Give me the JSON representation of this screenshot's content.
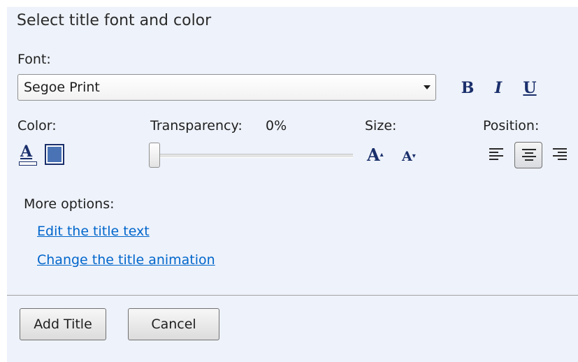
{
  "heading": "Select title font and color",
  "font": {
    "label": "Font:",
    "selected": "Segoe Print",
    "bold_label": "B",
    "italic_label": "I",
    "underline_label": "U"
  },
  "color": {
    "label": "Color:",
    "font_color_glyph": "A",
    "background_swatch": "#4a73b5",
    "accent": "#1a2f6b"
  },
  "transparency": {
    "label": "Transparency:",
    "value": "0%",
    "level": 0
  },
  "size": {
    "label": "Size:",
    "increase_glyph": "A",
    "decrease_glyph": "A",
    "up_arrow": "▴",
    "down_arrow": "▾"
  },
  "position": {
    "label": "Position:",
    "options": [
      "align-left",
      "align-center",
      "align-right"
    ],
    "selected": "align-center"
  },
  "more_options": {
    "label": "More options:",
    "links": [
      "Edit the title text",
      "Change the title animation"
    ]
  },
  "buttons": {
    "add_title": "Add Title",
    "cancel": "Cancel"
  }
}
